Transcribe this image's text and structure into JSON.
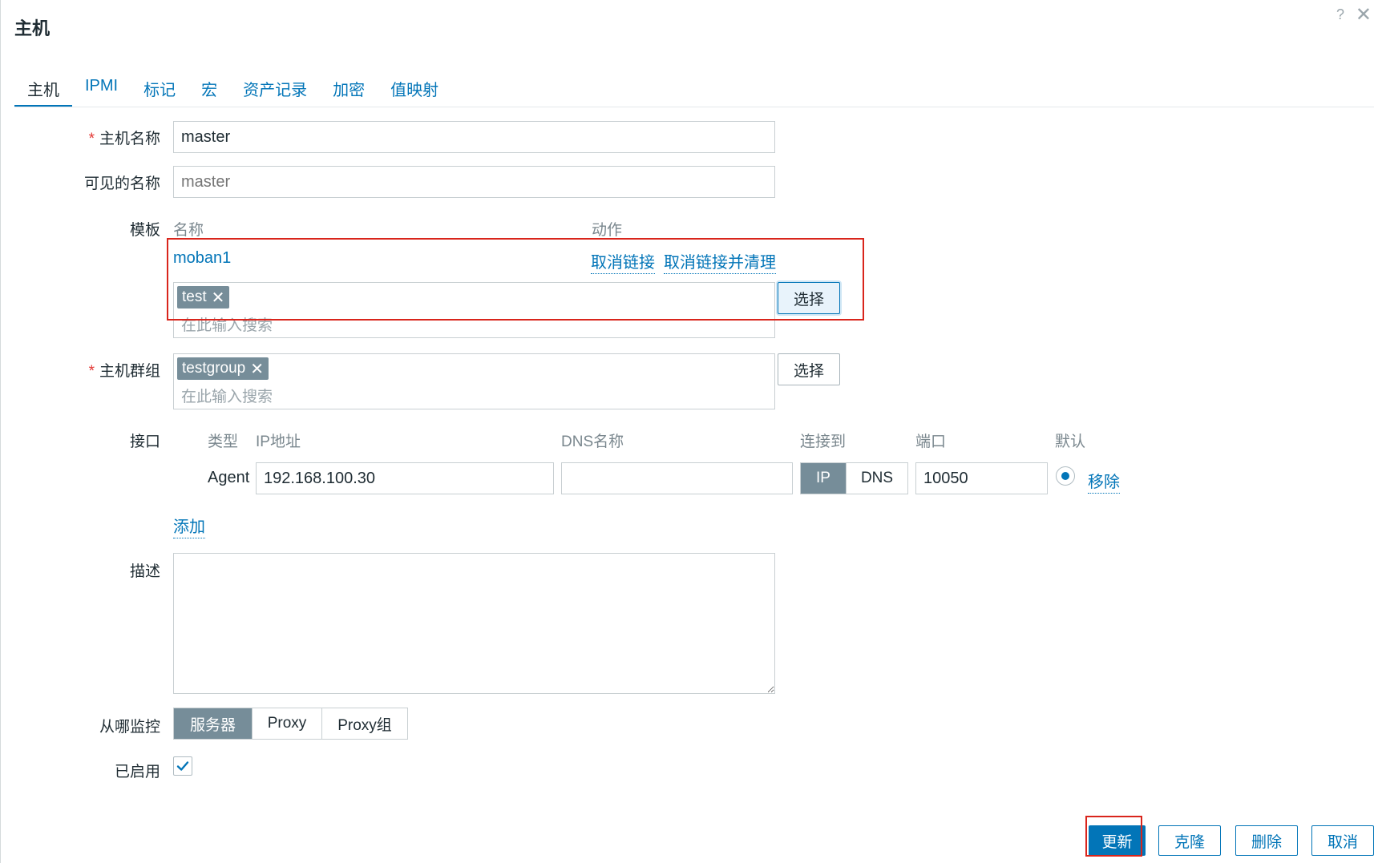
{
  "dialog": {
    "title": "主机",
    "help_glyph": "?",
    "close_glyph": "✕"
  },
  "tabs": [
    {
      "label": "主机",
      "active": true
    },
    {
      "label": "IPMI"
    },
    {
      "label": "标记"
    },
    {
      "label": "宏"
    },
    {
      "label": "资产记录"
    },
    {
      "label": "加密"
    },
    {
      "label": "值映射"
    }
  ],
  "form": {
    "host_name": {
      "label": "主机名称",
      "required_mark": "*",
      "value": "master"
    },
    "visible_name": {
      "label": "可见的名称",
      "placeholder": "master"
    },
    "templates": {
      "label": "模板",
      "col_name": "名称",
      "col_action": "动作",
      "linked": [
        {
          "name": "moban1",
          "unlink": "取消链接",
          "unlink_clear": "取消链接并清理"
        }
      ],
      "new_chips": [
        "test"
      ],
      "search_placeholder": "在此输入搜索",
      "select_button": "选择"
    },
    "host_groups": {
      "label": "主机群组",
      "required_mark": "*",
      "chips": [
        "testgroup"
      ],
      "search_placeholder": "在此输入搜索",
      "select_button": "选择"
    },
    "interfaces": {
      "label": "接口",
      "headers": {
        "type": "类型",
        "ip": "IP地址",
        "dns": "DNS名称",
        "connect_to": "连接到",
        "port": "端口",
        "default": "默认"
      },
      "rows": [
        {
          "type": "Agent",
          "ip": "192.168.100.30",
          "dns": "",
          "connect_options": [
            "IP",
            "DNS"
          ],
          "connect_selected": "IP",
          "port": "10050",
          "remove": "移除"
        }
      ],
      "add_link": "添加"
    },
    "description": {
      "label": "描述",
      "value": ""
    },
    "monitored_by": {
      "label": "从哪监控",
      "options": [
        "服务器",
        "Proxy",
        "Proxy组"
      ],
      "selected": "服务器"
    },
    "enabled": {
      "label": "已启用",
      "checked": true
    }
  },
  "footer": {
    "update": "更新",
    "clone": "克隆",
    "delete": "删除",
    "cancel": "取消"
  },
  "colors": {
    "accent": "#0275b8",
    "chip": "#768d99",
    "required": "#e33734",
    "highlight_box": "#d9251c"
  },
  "icons": {
    "help": "help-icon",
    "close": "close-icon",
    "chip_remove": "remove-x-icon",
    "checkmark": "checkmark-icon"
  }
}
